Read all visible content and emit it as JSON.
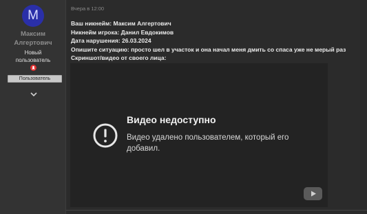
{
  "user": {
    "avatar_letter": "M",
    "name_line1": "Максим",
    "name_line2": "Алгертович",
    "title_line1": "Новый",
    "title_line2": "пользователь",
    "role_badge": "Пользователь",
    "award_icon": "red-badge-icon",
    "expand_icon": "chevron-down-icon"
  },
  "post": {
    "timestamp": "Вчера в 12:00",
    "lines": [
      "Ваш никнейм: Максим Алгертович",
      "Никнейм игрока: Данил Евдокимов",
      "Дата нарушения: 26.03.2024",
      "Опишите ситуацию: просто шел в участок и она начал меня дмить со спаса уже не мерый раз",
      "Скриншот/видео от своего лица:"
    ]
  },
  "video": {
    "error_title": "Видео недоступно",
    "error_text": "Видео удалено пользователем, который его добавил.",
    "error_icon": "exclamation-circle-icon",
    "platform_icon": "youtube-icon"
  },
  "colors": {
    "background": "#2b2b2b",
    "sidebar": "#333333",
    "avatar": "#2a2fa8",
    "award": "#e23232",
    "video_background": "#232323"
  }
}
